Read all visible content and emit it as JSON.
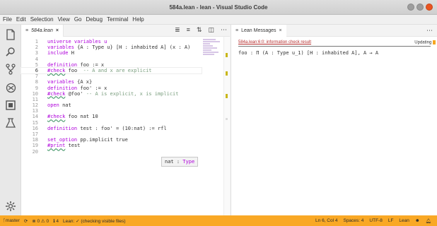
{
  "window": {
    "title": "584a.lean - lean - Visual Studio Code"
  },
  "menu": [
    "File",
    "Edit",
    "Selection",
    "View",
    "Go",
    "Debug",
    "Terminal",
    "Help"
  ],
  "activity_icons": [
    "files-icon",
    "search-icon",
    "source-control-icon",
    "debug-icon",
    "extensions-icon",
    "test-icon",
    "settings-gear-icon"
  ],
  "editor": {
    "tab_label": "584a.lean",
    "tab_close": "×",
    "lines": [
      {
        "n": "1",
        "segs": [
          {
            "t": "universe variables u",
            "c": "kw"
          }
        ]
      },
      {
        "n": "2",
        "segs": [
          {
            "t": "variables",
            "c": "kw"
          },
          {
            "t": " {A : Type u} [H : inhabited A] (x : A)",
            "c": ""
          }
        ]
      },
      {
        "n": "3",
        "segs": [
          {
            "t": "include",
            "c": "kw"
          },
          {
            "t": " H",
            "c": ""
          }
        ]
      },
      {
        "n": "4",
        "segs": []
      },
      {
        "n": "5",
        "segs": [
          {
            "t": "definition",
            "c": "kw"
          },
          {
            "t": " foo := x",
            "c": ""
          }
        ]
      },
      {
        "n": "6",
        "segs": [
          {
            "t": "#check",
            "c": "kw sq"
          },
          {
            "t": " foo  ",
            "c": ""
          },
          {
            "t": "-- A and x are explicit",
            "c": "cmt"
          }
        ],
        "current": true
      },
      {
        "n": "7",
        "segs": []
      },
      {
        "n": "8",
        "segs": [
          {
            "t": "variables",
            "c": "kw"
          },
          {
            "t": " {A x}",
            "c": ""
          }
        ]
      },
      {
        "n": "9",
        "segs": [
          {
            "t": "definition",
            "c": "kw"
          },
          {
            "t": " foo' := x",
            "c": ""
          }
        ]
      },
      {
        "n": "10",
        "segs": [
          {
            "t": "#check",
            "c": "kw sq"
          },
          {
            "t": " @foo' ",
            "c": ""
          },
          {
            "t": "-- A is explicit, x is implicit",
            "c": "cmt"
          }
        ]
      },
      {
        "n": "11",
        "segs": []
      },
      {
        "n": "12",
        "segs": [
          {
            "t": "open",
            "c": "kw"
          },
          {
            "t": " nat",
            "c": ""
          }
        ]
      },
      {
        "n": "13",
        "segs": []
      },
      {
        "n": "14",
        "segs": [
          {
            "t": "#check",
            "c": "kw sq"
          },
          {
            "t": " foo nat 10",
            "c": ""
          }
        ]
      },
      {
        "n": "15",
        "segs": []
      },
      {
        "n": "16",
        "segs": [
          {
            "t": "definition",
            "c": "kw"
          },
          {
            "t": " test : foo' = (10:nat) := rfl",
            "c": ""
          }
        ]
      },
      {
        "n": "17",
        "segs": []
      },
      {
        "n": "18",
        "segs": [
          {
            "t": "set_option",
            "c": "kw"
          },
          {
            "t": " pp.implicit true",
            "c": ""
          }
        ]
      },
      {
        "n": "19",
        "segs": [
          {
            "t": "#print",
            "c": "kw sq"
          },
          {
            "t": " test",
            "c": ""
          }
        ]
      },
      {
        "n": "20",
        "segs": []
      }
    ],
    "hover": {
      "name": "nat : ",
      "type": "Type"
    }
  },
  "messages": {
    "tab_label": "Lean Messages",
    "tab_close": "×",
    "header": "584a.lean:6:0: information check result",
    "updating": "Updating",
    "body": "foo : Π (A : Type u_1) [H : inhabited A], A → A"
  },
  "status": {
    "branch": "master",
    "sync": "⟳",
    "problems": "⊗ 0 ⚠ 0",
    "info": "ℹ 4",
    "lean_status": "Lean: ✓ (checking visible files)",
    "position": "Ln 6, Col 4",
    "spaces": "Spaces: 4",
    "encoding": "UTF-8",
    "eol": "LF",
    "language": "Lean"
  }
}
